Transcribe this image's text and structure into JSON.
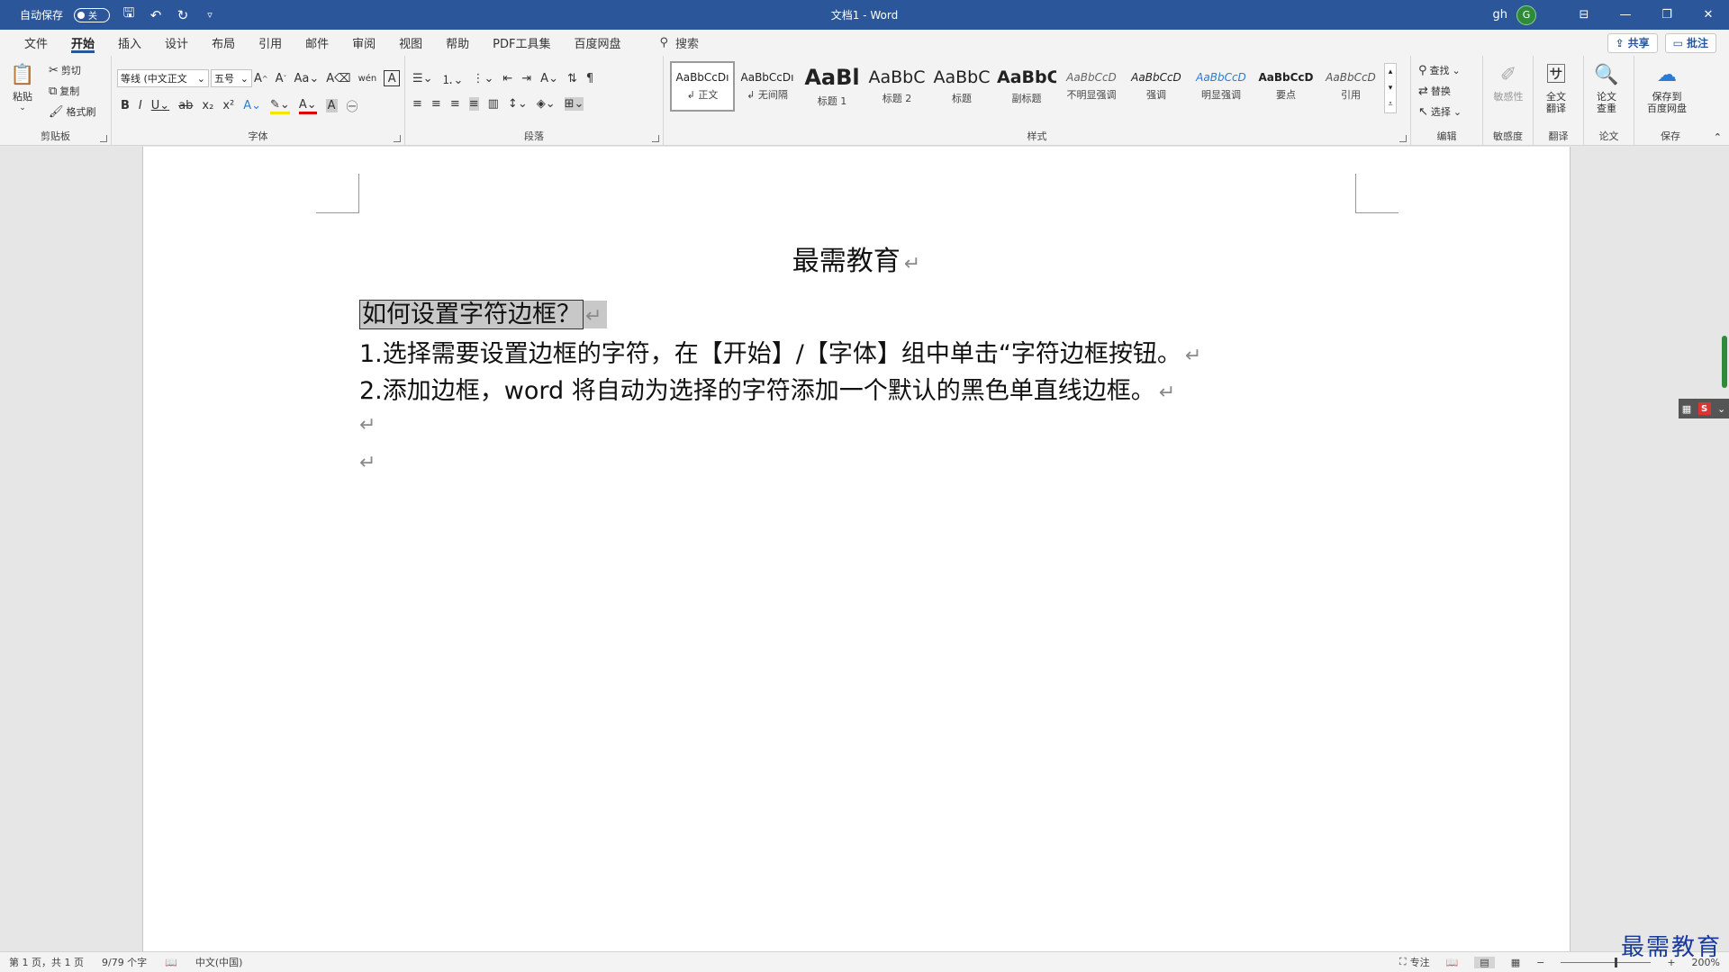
{
  "titlebar": {
    "autosave_label": "自动保存",
    "autosave_state": "关",
    "document_title": "文档1  -  Word",
    "user_name": "gh",
    "user_initial": "G"
  },
  "menu": {
    "tabs": [
      "文件",
      "开始",
      "插入",
      "设计",
      "布局",
      "引用",
      "邮件",
      "审阅",
      "视图",
      "帮助",
      "PDF工具集",
      "百度网盘"
    ],
    "search_label": "搜索",
    "share_label": "共享",
    "comments_label": "批注"
  },
  "ribbon": {
    "clipboard": {
      "paste": "粘贴",
      "cut": "剪切",
      "copy": "复制",
      "format_painter": "格式刷",
      "label": "剪贴板"
    },
    "font": {
      "font_name": "等线 (中文正文",
      "font_size": "五号",
      "label": "字体",
      "char_border": "A"
    },
    "paragraph": {
      "label": "段落"
    },
    "styles": {
      "label": "样式",
      "items": [
        {
          "preview": "AaBbCcDı",
          "name": "↲ 正文"
        },
        {
          "preview": "AaBbCcDı",
          "name": "↲ 无间隔"
        },
        {
          "preview": "AaBl",
          "name": "标题 1"
        },
        {
          "preview": "AaBbC",
          "name": "标题 2"
        },
        {
          "preview": "AaBbC",
          "name": "标题"
        },
        {
          "preview": "AaBbC",
          "name": "副标题"
        },
        {
          "preview": "AaBbCcD",
          "name": "不明显强调"
        },
        {
          "preview": "AaBbCcD",
          "name": "强调"
        },
        {
          "preview": "AaBbCcD",
          "name": "明显强调"
        },
        {
          "preview": "AaBbCcD",
          "name": "要点"
        },
        {
          "preview": "AaBbCcD",
          "name": "引用"
        }
      ]
    },
    "editing": {
      "find": "查找",
      "replace": "替换",
      "select": "选择",
      "label": "编辑"
    },
    "sensitivity": {
      "button": "敏感性",
      "label": "敏感度"
    },
    "translate": {
      "button_line1": "全文",
      "button_line2": "翻译",
      "label": "翻译"
    },
    "paper": {
      "button_line1": "论文",
      "button_line2": "查重",
      "label": "论文"
    },
    "save": {
      "button_line1": "保存到",
      "button_line2": "百度网盘",
      "label": "保存"
    }
  },
  "document": {
    "title": "最需教育",
    "heading": "如何设置字符边框？",
    "para1": "1.选择需要设置边框的字符，在【开始】/【字体】组中单击“字符边框按钮。",
    "para2": "2.添加边框，word 将自动为选择的字符添加一个默认的黑色单直线边框。",
    "para_mark": "↵"
  },
  "statusbar": {
    "page": "第 1 页，共 1 页",
    "words": "9/79 个字",
    "language": "中文(中国)",
    "focus": "专注",
    "zoom": "200%"
  },
  "watermark": "最需教育",
  "colors": {
    "accent": "#2b579a",
    "avatar": "#2e8b3a"
  }
}
